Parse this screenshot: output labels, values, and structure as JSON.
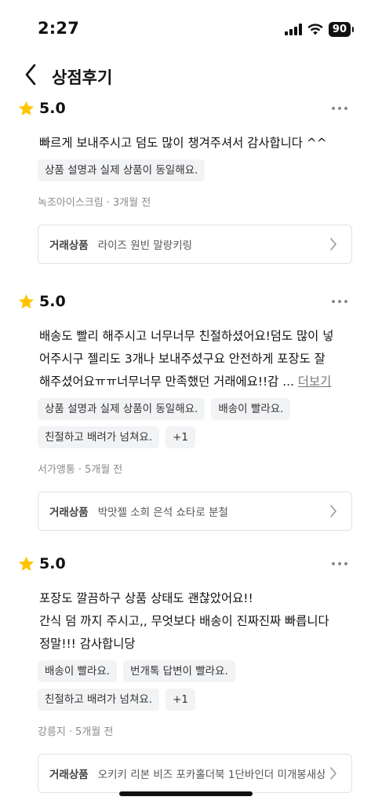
{
  "status_bar": {
    "time": "2:27",
    "battery": "90"
  },
  "header": {
    "title": "상점후기"
  },
  "reviews": [
    {
      "score": "5.0",
      "text_lines": [
        "빠르게 보내주시고 덤도 많이 챙겨주셔서 감사합니다 ^^"
      ],
      "more_label": "",
      "tags": [
        "상품 설명과 실제 상품이 동일해요."
      ],
      "author": "녹조아이스크림",
      "time": "3개월 전",
      "product_label": "거래상품",
      "product_name": "라이즈 원빈 말랑키링"
    },
    {
      "score": "5.0",
      "text_lines": [
        "배송도 빨리 해주시고 너무너무 친절하셨어요!덤도 많이 넣",
        "어주시구 젤리도 3개나 보내주셨구요 안전하게 포장도 잘",
        "해주셨어요ㅠㅠ너무너무 만족했던 거래에요!!감 ..."
      ],
      "more_label": "더보기",
      "tags": [
        "상품 설명과 실제 상품이 동일해요.",
        "배송이 빨라요.",
        "친절하고 배려가 넘쳐요.",
        "+1"
      ],
      "author": "서가앵통",
      "time": "5개월 전",
      "product_label": "거래상품",
      "product_name": "박맛젤 소희 은석 쇼타로 분철"
    },
    {
      "score": "5.0",
      "text_lines": [
        "포장도 깔끔하구 상품 상태도 괜찮았어요!!",
        "간식 덤 까지 주시고,, 무엇보다 배송이 진짜진짜 빠릅니다",
        "정말!!! 감사합니당"
      ],
      "more_label": "",
      "tags": [
        "배송이 빨라요.",
        "번개톡 답변이 빨라요.",
        "친절하고 배려가 넘쳐요.",
        "+1"
      ],
      "author": "강릉지",
      "time": "5개월 전",
      "product_label": "거래상품",
      "product_name": "오키키 리본 비즈 포카홀더북 1단바인더 미개봉새상"
    }
  ],
  "colors": {
    "star": "#FFC400",
    "tag_bg": "#F2F3F5",
    "meta_text": "#8A8A8A"
  },
  "icons": {
    "back": "chevron-left-icon",
    "more": "more-dots-icon",
    "star": "star-icon",
    "chevron": "chevron-right-icon"
  }
}
